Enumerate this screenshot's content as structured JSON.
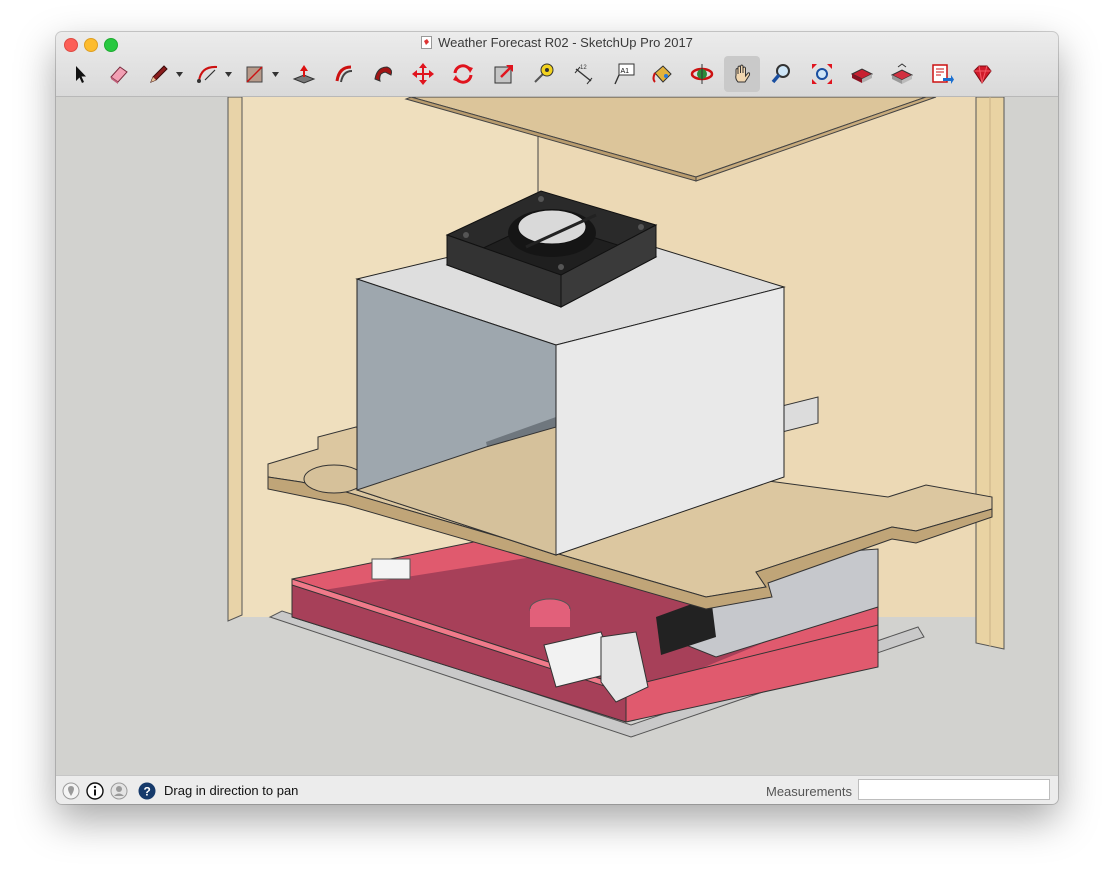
{
  "window": {
    "title": "Weather Forecast R02 - SketchUp Pro 2017"
  },
  "toolbar": {
    "tools": [
      {
        "name": "select-tool",
        "icon": "arrow-icon"
      },
      {
        "name": "eraser-tool",
        "icon": "eraser-icon"
      },
      {
        "name": "line-tool",
        "icon": "pencil-icon",
        "dropdown": true
      },
      {
        "name": "arc-tool",
        "icon": "arc-icon",
        "dropdown": true
      },
      {
        "name": "rectangle-tool",
        "icon": "rectangle-icon",
        "dropdown": true
      },
      {
        "name": "push-pull-tool",
        "icon": "push-pull-icon"
      },
      {
        "name": "offset-tool",
        "icon": "offset-icon"
      },
      {
        "name": "follow-me-tool",
        "icon": "follow-me-icon"
      },
      {
        "name": "move-tool",
        "icon": "move-icon"
      },
      {
        "name": "rotate-tool",
        "icon": "rotate-icon"
      },
      {
        "name": "scale-tool",
        "icon": "scale-icon"
      },
      {
        "name": "tape-measure-tool",
        "icon": "tape-measure-icon"
      },
      {
        "name": "dimension-tool",
        "icon": "dimension-icon"
      },
      {
        "name": "text-tool",
        "icon": "text-icon"
      },
      {
        "name": "paint-bucket-tool",
        "icon": "paint-bucket-icon"
      },
      {
        "name": "orbit-tool",
        "icon": "orbit-icon"
      },
      {
        "name": "pan-tool",
        "icon": "hand-icon",
        "active": true
      },
      {
        "name": "zoom-tool",
        "icon": "magnifier-icon"
      },
      {
        "name": "zoom-extents-tool",
        "icon": "zoom-extents-icon"
      },
      {
        "name": "3d-warehouse-tool",
        "icon": "warehouse-icon"
      },
      {
        "name": "share-model-tool",
        "icon": "share-model-icon"
      },
      {
        "name": "layout-tool",
        "icon": "layout-icon"
      },
      {
        "name": "extension-warehouse-tool",
        "icon": "ruby-icon"
      }
    ],
    "text_tool_label": "A1"
  },
  "statusbar": {
    "message": "Drag in direction to pan",
    "measurements_label": "Measurements",
    "measurements_value": ""
  },
  "colors": {
    "plywood": "#ecdcba",
    "plywood_shade": "#d8c59d",
    "enclosure_front": "#e8e8e8",
    "enclosure_side": "#9ea7ae",
    "tray_red": "#e05a6e",
    "tray_dark": "#a74059",
    "fan": "#222222",
    "viewport_bg": "#d2d2cf"
  }
}
